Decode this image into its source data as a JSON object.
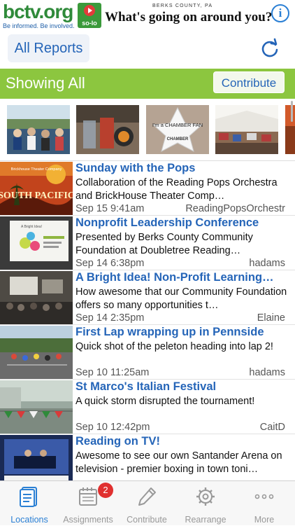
{
  "header": {
    "logo_text": "bctv.org",
    "logo_tagline": "Be informed. Be involved.",
    "solo_label": "so-lo",
    "county": "BERKS COUNTY, PA",
    "headline": "What's going on around you?",
    "info_icon": "info-icon"
  },
  "nav": {
    "all_reports": "All Reports",
    "refresh_icon": "refresh-icon"
  },
  "filter_bar": {
    "title": "Showing All",
    "contribute_label": "Contribute",
    "accent": "#8cc63f"
  },
  "thumbnails": [
    {
      "name": "thumb-crowd"
    },
    {
      "name": "thumb-drinks"
    },
    {
      "name": "thumb-chamber-fan",
      "caption": "I'm a CHAMBER FAN",
      "sub": "CHAMBER"
    },
    {
      "name": "thumb-tent"
    },
    {
      "name": "thumb-partial"
    }
  ],
  "feed": [
    {
      "title": "Sunday with the Pops",
      "description": "Collaboration of the Reading Pops Orchestra and BrickHouse Theater Comp…",
      "date": "Sep 15  9:41am",
      "author": "ReadingPopsOrchestr",
      "image_text": "SOUTH PACIFIC",
      "image_sub": "Brickhouse Theater Company"
    },
    {
      "title": "Nonprofit Leadership Conference",
      "description": "Presented by Berks County Community Foundation at Doubletree Reading…",
      "date": "Sep 14  6:38pm",
      "author": "hadams",
      "image_text": "A Bright Idea!"
    },
    {
      "title": "A Bright Idea!  Non-Profit Learning…",
      "description": "How awesome that our Community Foundation offers so many opportunities t…",
      "date": "Sep 14  2:35pm",
      "author": "Elaine"
    },
    {
      "title": "First Lap wrapping up in Pennside",
      "description": "Quick shot of the peleton heading into lap 2!",
      "date": "Sep 10  11:25am",
      "author": "hadams"
    },
    {
      "title": "St Marco's Italian Festival",
      "description": "A quick storm disrupted the tournament!",
      "date": "Sep 10  12:42pm",
      "author": "CaitD"
    },
    {
      "title": "Reading on TV!",
      "description": "Awesome to see our own Santander Arena on television  - premier boxing in town toni…",
      "date": "",
      "author": ""
    }
  ],
  "tabbar": {
    "tabs": [
      {
        "label": "Locations",
        "icon": "locations-icon",
        "active": true
      },
      {
        "label": "Assignments",
        "icon": "calendar-icon",
        "badge": "2"
      },
      {
        "label": "Contribute",
        "icon": "pencil-icon"
      },
      {
        "label": "Rearrange",
        "icon": "gear-icon"
      },
      {
        "label": "More",
        "icon": "more-icon"
      }
    ]
  },
  "colors": {
    "link_blue": "#2565b8",
    "active_tab": "#2a7fd4",
    "badge_red": "#e0302f"
  }
}
